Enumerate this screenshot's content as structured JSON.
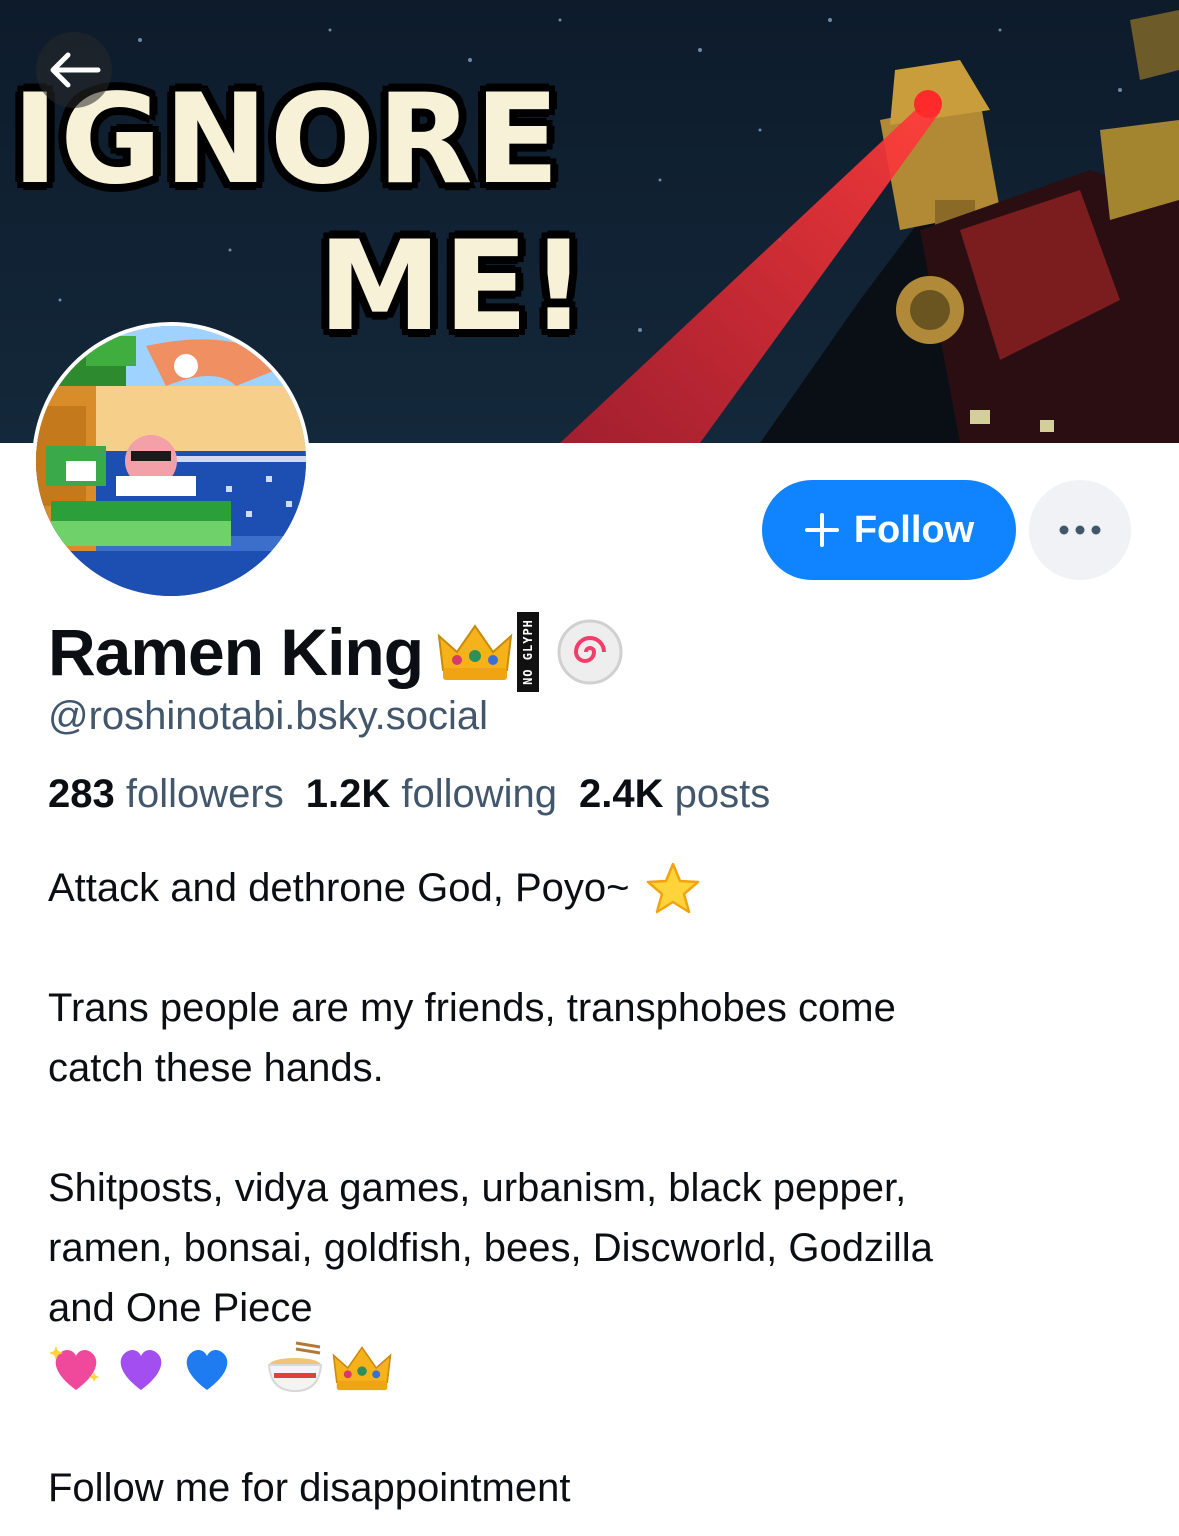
{
  "banner": {
    "line1": "IGNORE",
    "line2": "ME!"
  },
  "profile": {
    "display_name": "Ramen King",
    "no_glyph_tag": "NO GLYPH",
    "handle": "@roshinotabi.bsky.social",
    "stats": {
      "followers_count": "283",
      "followers_label": "followers",
      "following_count": "1.2K",
      "following_label": "following",
      "posts_count": "2.4K",
      "posts_label": "posts"
    },
    "bio": {
      "line1": "Attack and dethrone God, Poyo~",
      "line2": "Trans people are my friends, transphobes come",
      "line3": "catch these hands.",
      "line4": "Shitposts, vidya games, urbanism, black pepper,",
      "line5": "ramen, bonsai, goldfish, bees, Discworld, Godzilla",
      "line6": "and One Piece",
      "line7": "Follow me for disappointment"
    }
  },
  "actions": {
    "follow_label": "Follow",
    "follow_color": "#1083fe"
  },
  "icons": [
    "back-arrow-icon",
    "plus-icon",
    "more-dots-icon",
    "crown-emoji-icon",
    "narutomaki-emoji-icon",
    "star-emoji-icon",
    "sparkling-heart-icon",
    "purple-heart-icon",
    "blue-heart-icon",
    "ramen-bowl-icon"
  ]
}
